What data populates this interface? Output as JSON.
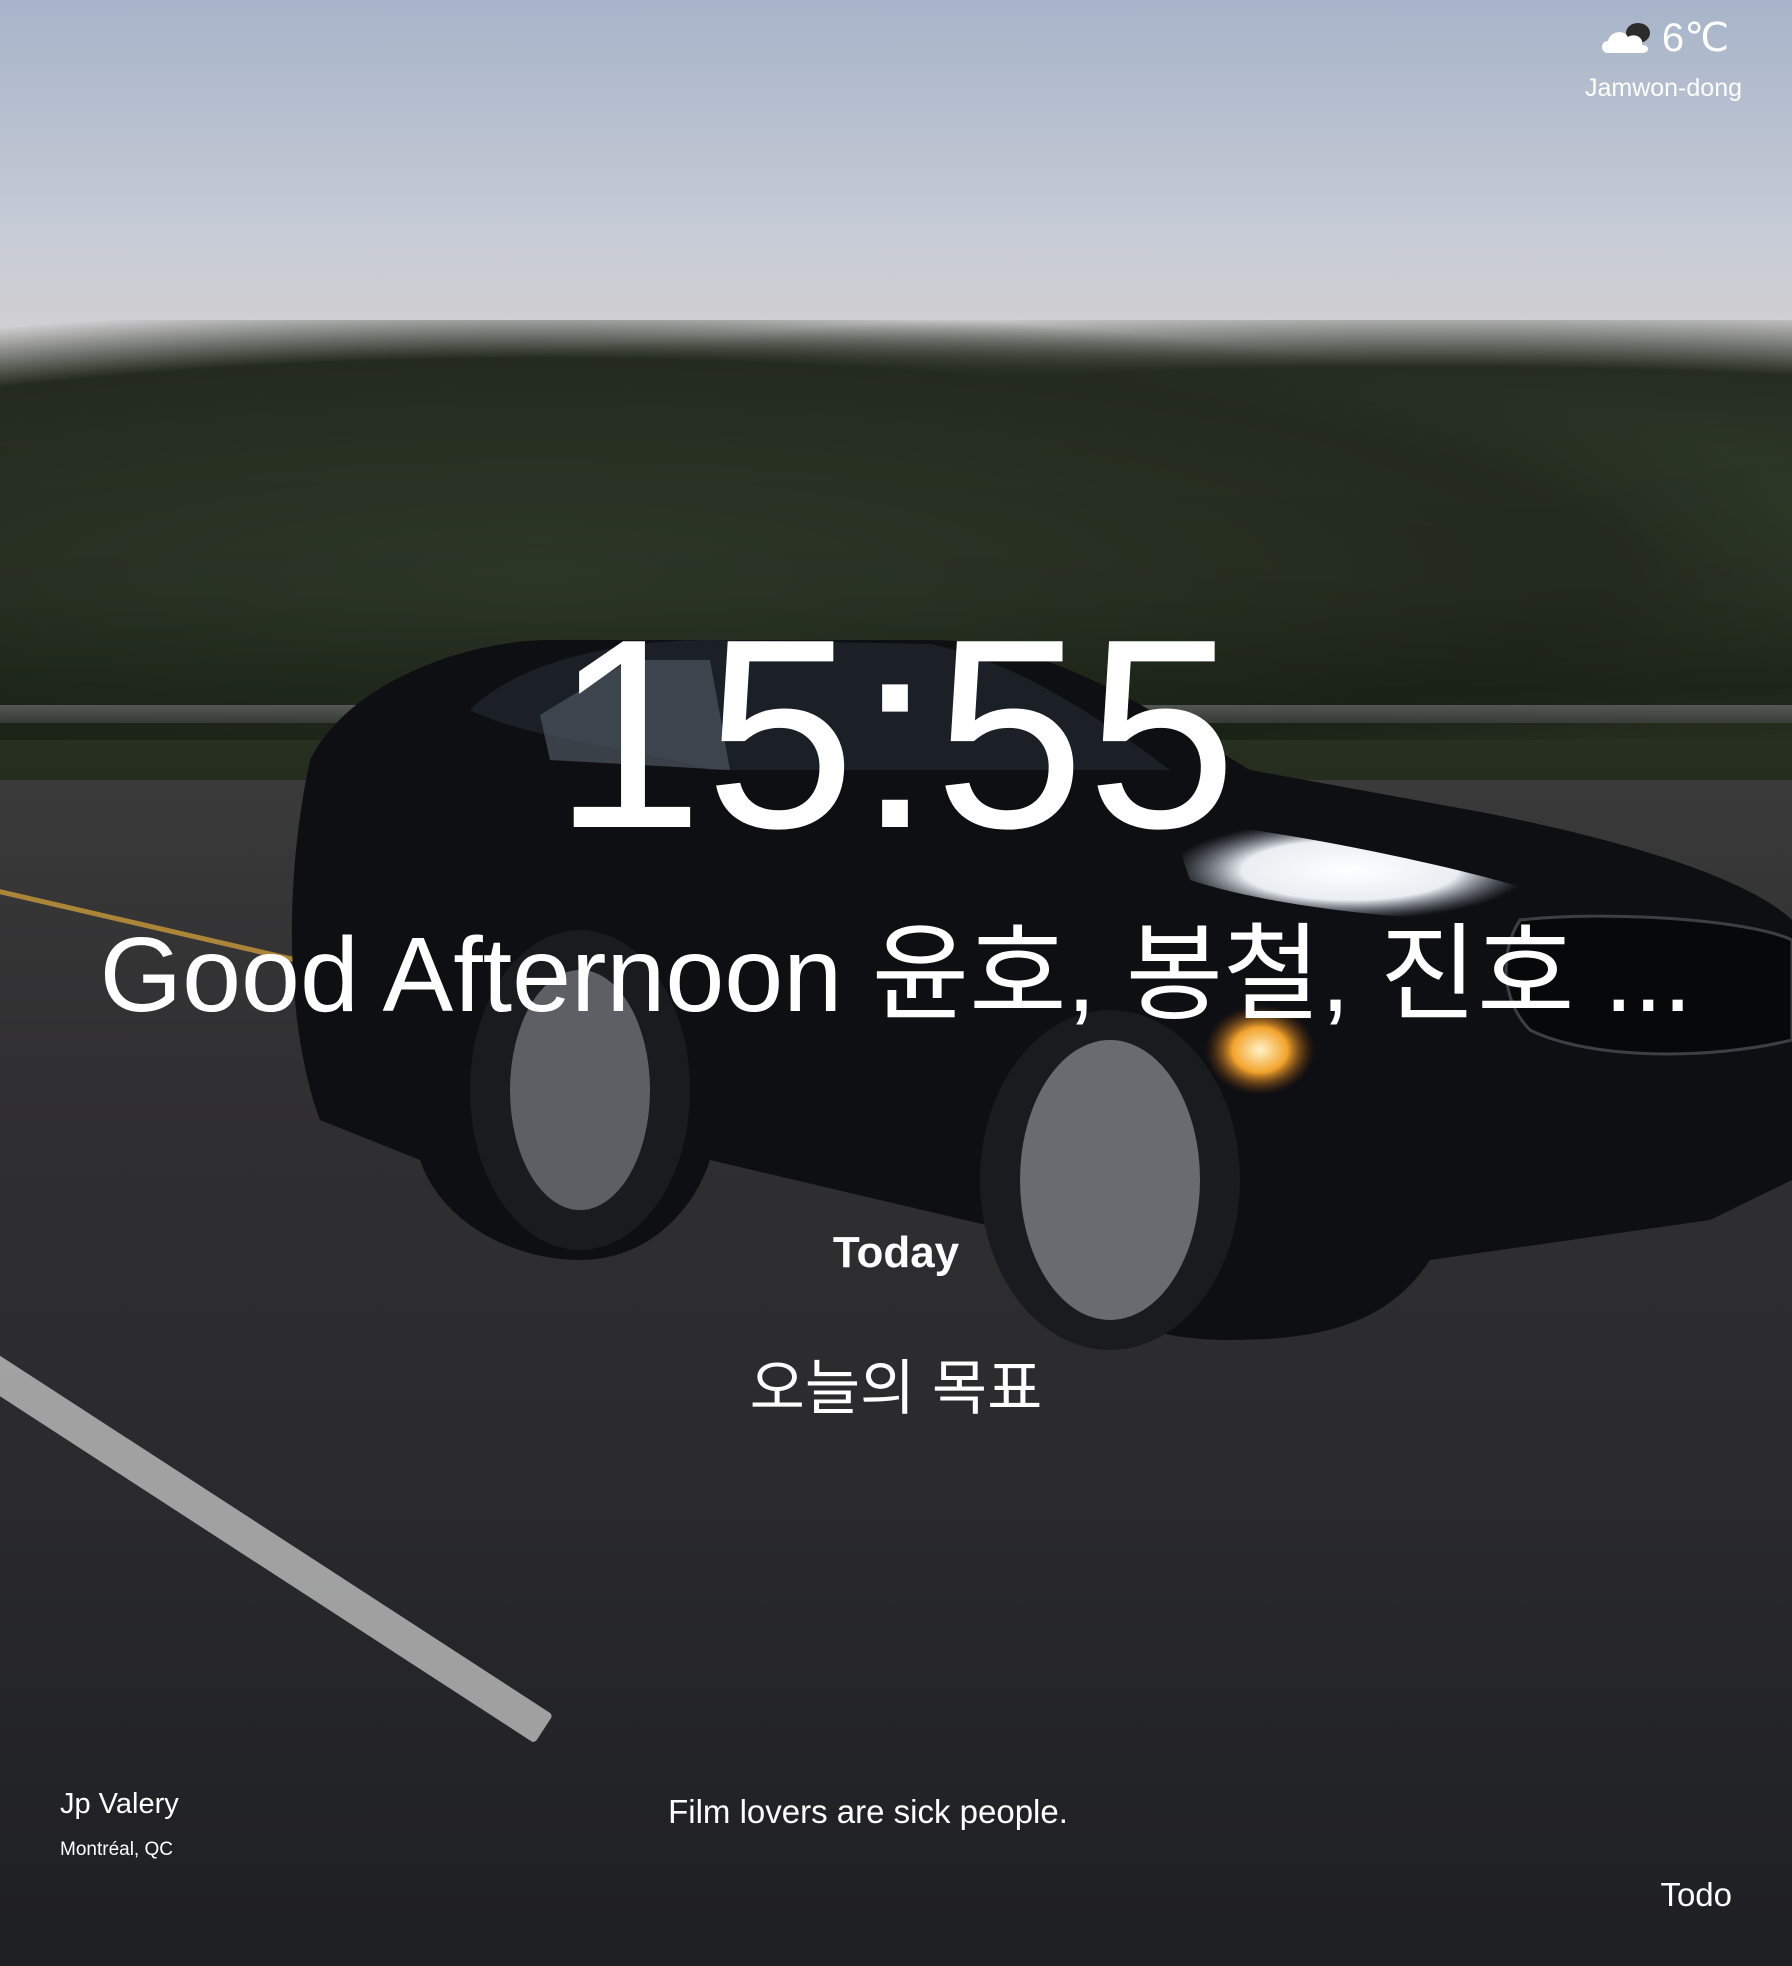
{
  "weather": {
    "icon": "cloud-icon",
    "temperature": "6℃",
    "location": "Jamwon-dong"
  },
  "clock": {
    "time": "15:55"
  },
  "greeting": {
    "text": "Good Afternoon 윤호, 봉철, 진호 ..."
  },
  "focus": {
    "label": "Today",
    "goal": "오늘의 목표"
  },
  "photo_credit": {
    "name": "Jp Valery",
    "location": "Montréal, QC"
  },
  "quote": {
    "text": "Film lovers are sick people."
  },
  "todo": {
    "label": "Todo"
  }
}
